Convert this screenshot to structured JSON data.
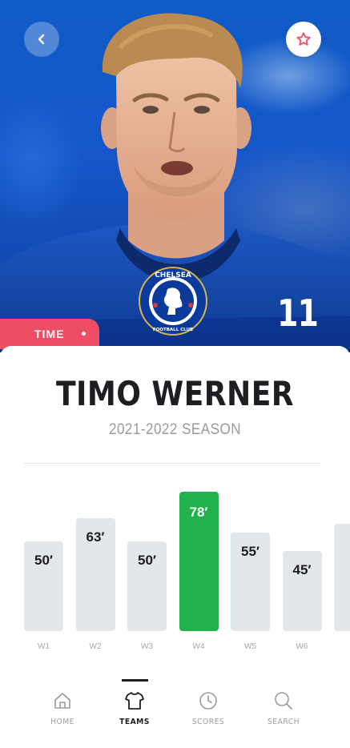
{
  "player": {
    "name": "TIMO WERNER",
    "season": "2021-2022 SEASON",
    "number": "11",
    "club_badge_text": [
      "CHELSEA",
      "FOOTBALL CLUB"
    ]
  },
  "hero": {
    "time_tab_label": "TIME",
    "accent_color": "#ef4d66"
  },
  "icons": {
    "back": "chevron-left-icon",
    "favorite": "star-icon"
  },
  "chart_data": {
    "type": "bar",
    "categories": [
      "W1",
      "W2",
      "W3",
      "W4",
      "W5",
      "W6"
    ],
    "values": [
      50,
      63,
      50,
      78,
      55,
      45
    ],
    "value_labels": [
      "50′",
      "63′",
      "50′",
      "78′",
      "55′",
      "45′"
    ],
    "highlight_index": 3,
    "colors": {
      "bar": "#e4e7ea",
      "highlight": "#21b24b"
    }
  },
  "bottom_nav": {
    "items": [
      {
        "label": "HOME",
        "icon": "home-icon"
      },
      {
        "label": "TEAMS",
        "icon": "shirt-icon",
        "active": true
      },
      {
        "label": "SCORES",
        "icon": "clock-icon"
      },
      {
        "label": "SEARCH",
        "icon": "search-icon"
      }
    ]
  }
}
